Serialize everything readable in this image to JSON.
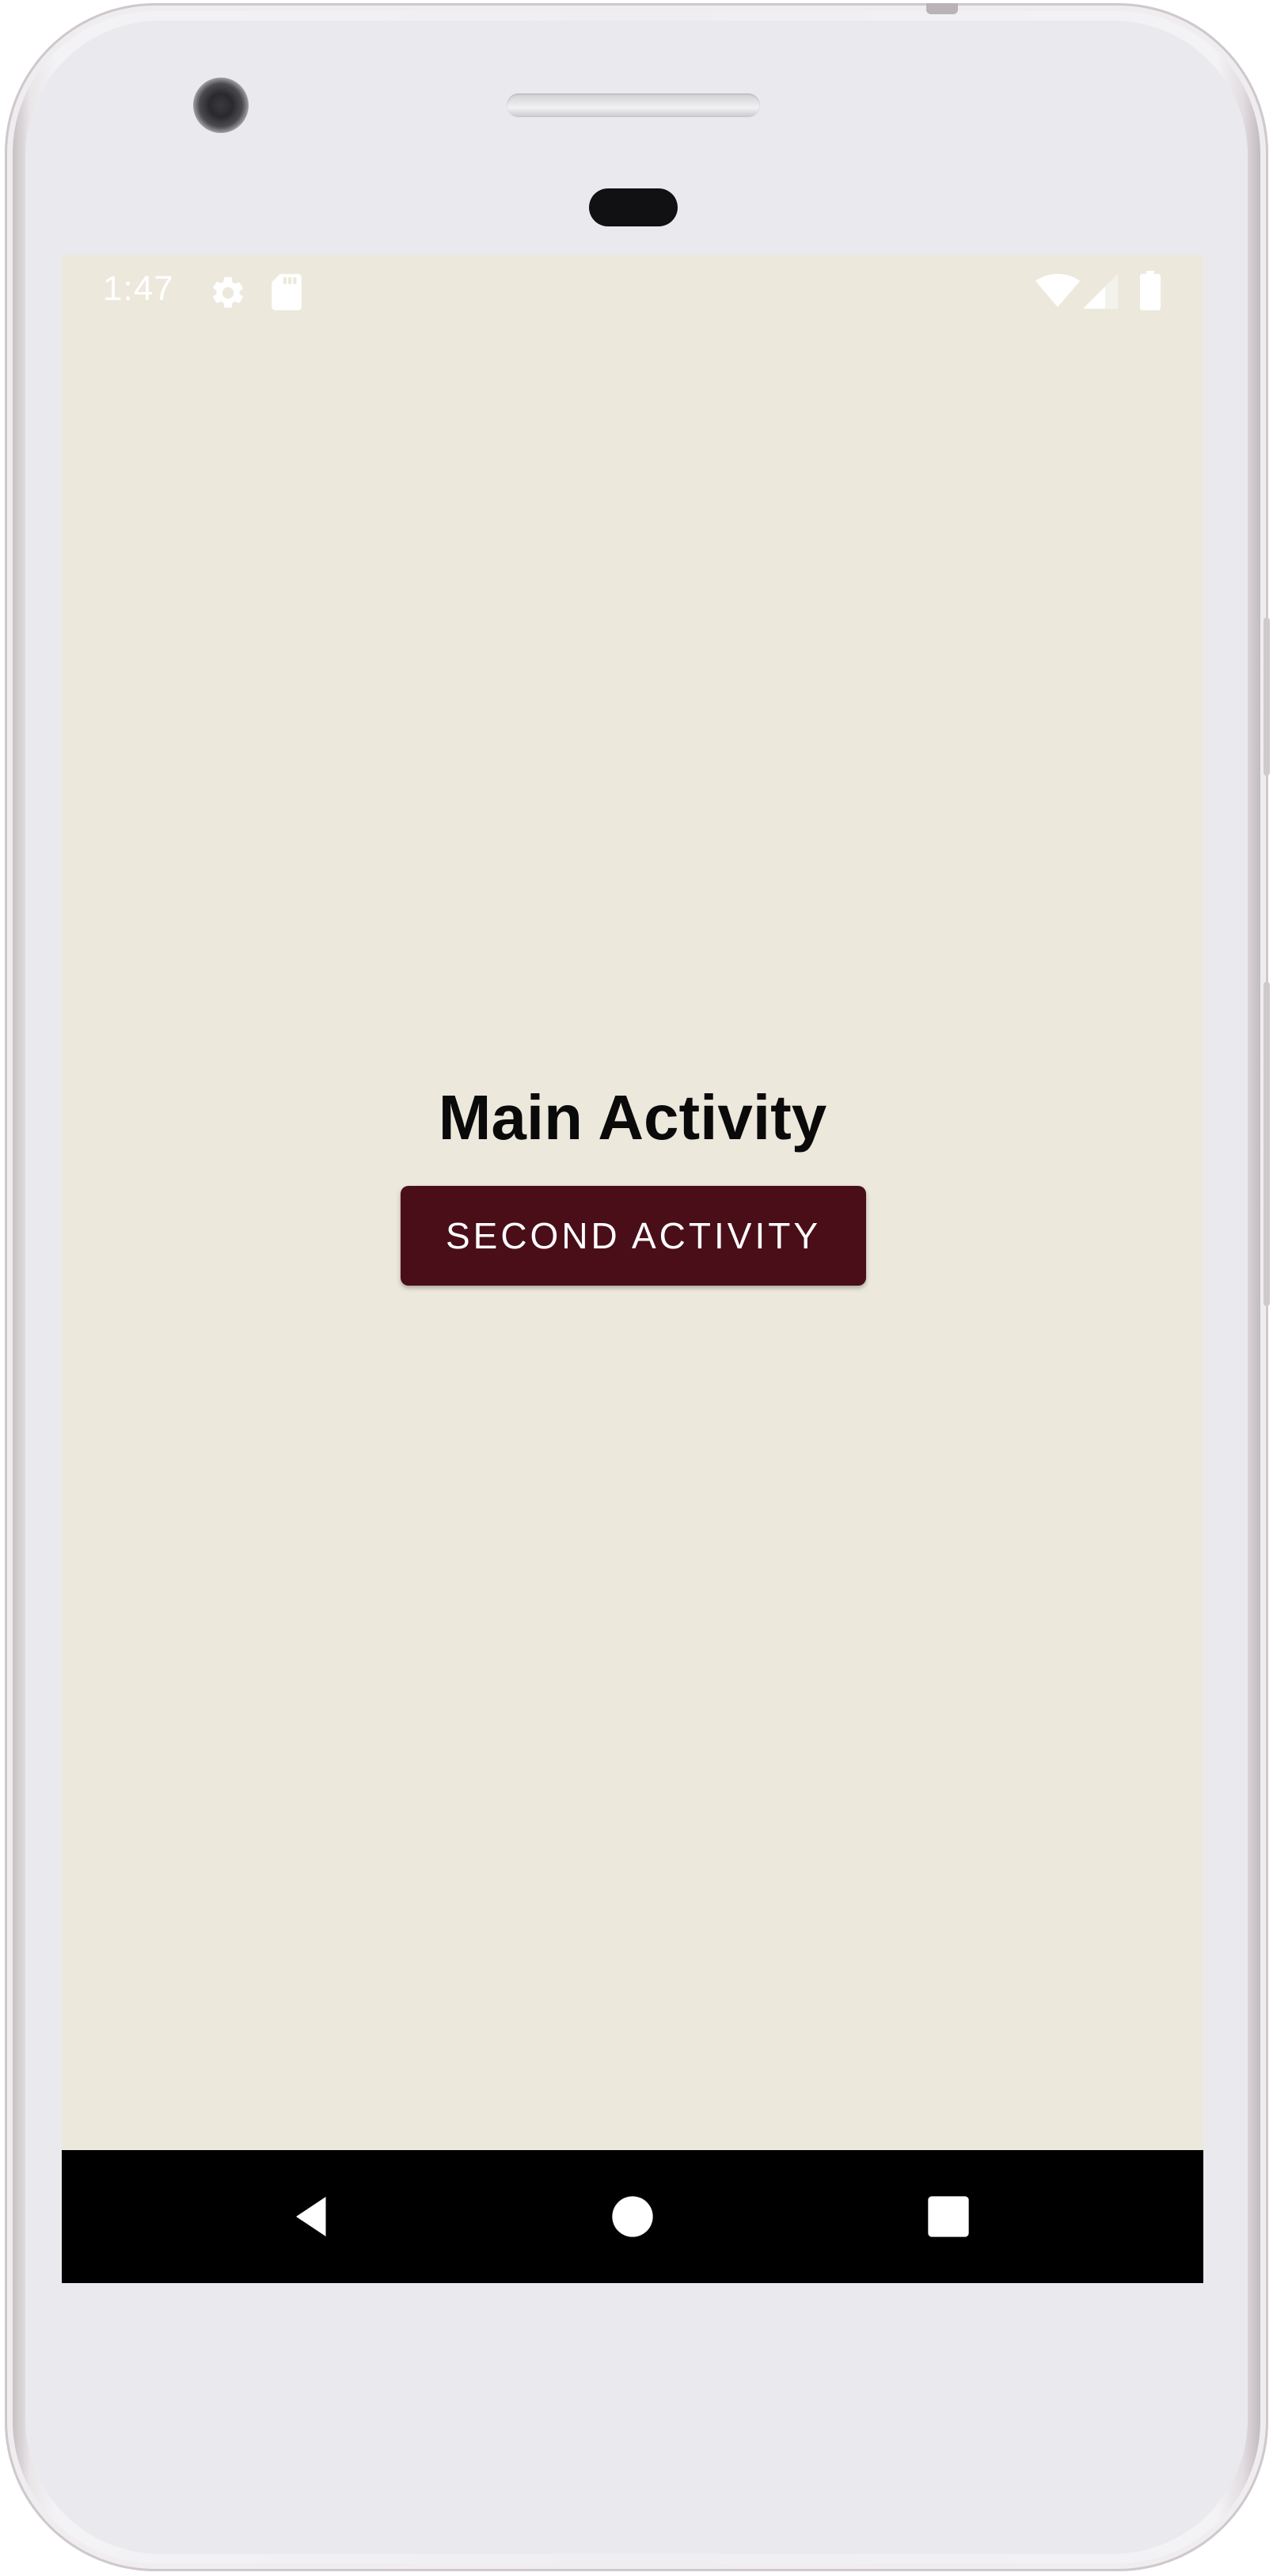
{
  "status_bar": {
    "time": "1:47",
    "left_icons": [
      "settings-icon",
      "sd-card-icon"
    ],
    "right_icons": [
      "wifi-icon",
      "cell-signal-icon",
      "battery-icon"
    ],
    "icon_color": "#ffffff"
  },
  "main": {
    "title": "Main Activity",
    "button_label": "SECOND ACTIVITY",
    "background_color": "#ece8dc",
    "button_color": "#4a0e19"
  },
  "nav_bar": {
    "buttons": [
      "back-icon",
      "home-icon",
      "recents-icon"
    ],
    "background_color": "#000000"
  }
}
